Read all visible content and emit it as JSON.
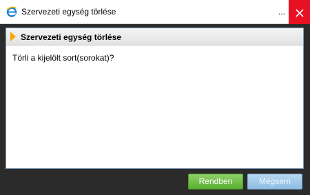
{
  "window": {
    "title": "Szervezeti egység törlése",
    "more_label": "...",
    "close_label": "Close"
  },
  "panel": {
    "title": "Szervezeti egység törlése",
    "message": "Törli a kijelölt sort(sorokat)?"
  },
  "buttons": {
    "ok_label": "Rendben",
    "cancel_label": "Mégsem"
  },
  "colors": {
    "close_red": "#e81123",
    "ok_green": "#59b02f",
    "cancel_blue": "#8dbde3",
    "panel_accent": "#f5a400"
  },
  "icons": {
    "app": "ie-icon",
    "close": "close-icon",
    "panel_marker": "arrow-right-icon"
  }
}
